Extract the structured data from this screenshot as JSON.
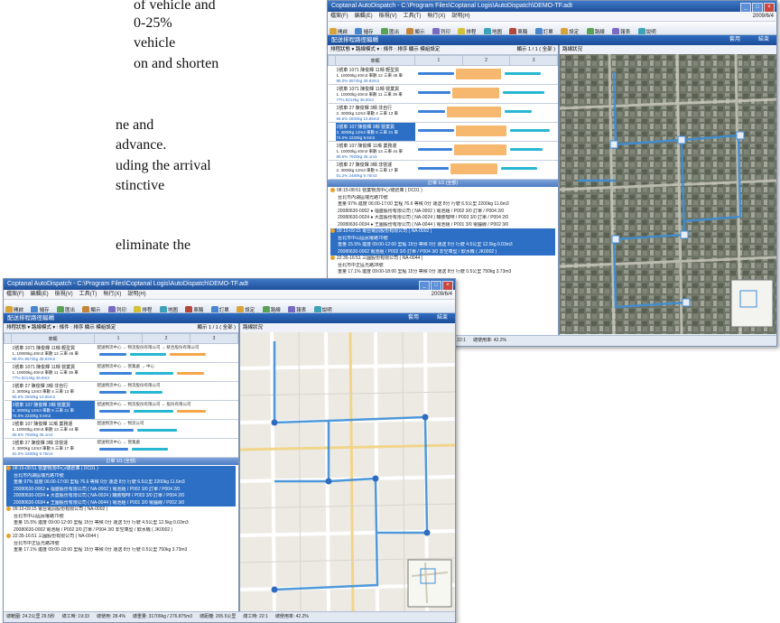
{
  "background_text": {
    "lines": [
      "of vehicle and",
      "0-25%",
      "vehicle",
      "on and shorten",
      "ne and",
      "advance.",
      "uding the arrival",
      "stinctive",
      "eliminate the"
    ]
  },
  "app": {
    "title": "Coptanal AutoDispatch - C:\\Program Files\\Coptanal Logis\\AutoDispatch\\DEMO-TF.adt",
    "menu": [
      "檔案(F)",
      "編輯(E)",
      "檢視(V)",
      "工具(T)",
      "執行(X)",
      "說明(H)"
    ],
    "date": "2009/6/4",
    "toolbar": [
      "開啟",
      "儲存",
      "匯出",
      "顯示",
      "列印",
      "排程",
      "地圖",
      "車輛",
      "訂單",
      "設定",
      "路線",
      "報表",
      "說明"
    ],
    "panel_title": "配送排程路徑編輯",
    "panel_btn1": "套用",
    "panel_btn2": "結束",
    "filter": "排程狀態 ▾  路線模式 ▾  :  條件  : 排序  顯示  模組設定",
    "filter_right": "顯示 1 / 1 ( 全部 )",
    "map_tab": "路線狀況",
    "grid_headers": [
      "",
      "車輛",
      "1",
      "2",
      "3"
    ],
    "rows": [
      {
        "name": "1號車 1071 陳俊輝 11噸 輕型貨",
        "detail": "1. 10000kg 40m3  車數 12 三車 46 車",
        "pct": "88.0% 8574kg 39.83m3",
        "stops": "配送物流中心 → 物流股份有限公司 → 統合股份有限公司"
      },
      {
        "name": "1號車 1071 陳俊輝 11噸 營業貨",
        "detail": "1. 10000kg 40m3  車數 11 三車 39 車",
        "pct": "77% 8214kg 36.8m3",
        "stops": "配送物流中心 → 營業處 → 中心"
      },
      {
        "name": "1號車 27 陳俊輝 3噸 非自行",
        "detail": "2. 3000kg 12m3  車數 4 三車 13 車",
        "pct": "86.6% 2600kg 10.85m3",
        "stops": "配送物流中心 → 物流股份有限公司"
      },
      {
        "name": "1號車 107 陳俊輝 3噸 營業貨",
        "detail": "3. 3000kg 12m3  車數 6 三車 21 車",
        "pct": "74.0% 2220kg 8.6m3",
        "stops": "配送物流中心 → 物流股份有限公司 → 股份有限公司"
      },
      {
        "name": "1號車 107 陳俊輝 11噸 業務運",
        "detail": "1. 10000kg 40m3  車數 13 三車 44 車",
        "pct": "86.6% 7920kg 35.1m3",
        "stops": "配送物流中心 → 物流公司"
      },
      {
        "name": "1號車 27 陳俊輝 3噸 非營運",
        "detail": "2. 3000kg 12m3  車數 5 三車 17 車",
        "pct": "81.2% 2480kg 9.75m3",
        "stops": "配送物流中心 → 營業處"
      }
    ],
    "splitter": "訂單 1/1 (全部)",
    "tree": [
      "08:15-08:51 營業物流中心/總倉庫 ( DC01 )",
      "台北市內湖區瑞光路70號",
      "重量 97%  進度 06:00-17:00  里程 76.6  等候 0分  運送 8分  行駛 6.5公里 2200kg 11.6m3",
      "20080630-0002 ● 福盛股份有限公司 ( NA-0002 ) 電池組 / P002 3/0 訂單 / P004 2/0",
      "20080630-0024 ● 大農股份有限公司 ( NA-0024 ) 罐裝咖啡 / P003 3/0 訂單 / P004 2/0",
      "20080630-0034 ● 王圖股份有限公司 ( NA-0044 ) 電池組 / P001 3/0 電腦線 / P002 3/0",
      "09:10-09:15 電台電訊股份有限公司 ( NA-0002 )",
      "台北市中山區民權路70號",
      "重量 15.5%  進度 09:00-12:00  里程 15分  等候 0分  運送 5分  行駛 4.5公里 12.5kg 0.03m3",
      "20080630-0002 電池組 / P002 3/0 訂單 / P004 3/0  非空車型 / 飲水機 ( JK0002 )",
      "22:35-16:51 三圓股份有限公司 ( NA-0044 )",
      "台北市中正區光路28號",
      "重量 17.1%  進度 09:00-18:00  里程 15分  等候 0分  運送 8分  行駛 0.5公里 750kg 3.73m3"
    ],
    "status": [
      "總範圍: 24.2公里 29.5秒",
      "總工時: 19:33",
      "總使用: 28.4%",
      "總重量: 31709kg / 276.875m3",
      "總距離: 205.5公里",
      "總工時: 22:1",
      "總使用率: 42.2%"
    ]
  },
  "colors": {
    "titlebar": "#1f4f99",
    "highlight": "#2d6fc4",
    "route": "#3c8ed6",
    "bar_blue": "#3d82d8",
    "bar_orange": "#f3a64a",
    "bar_cyan": "#28b7d3"
  },
  "icons": [
    "window-icon",
    "minimize-icon",
    "maximize-icon",
    "close-icon",
    "expand-icon",
    "vehicle-icon",
    "map-marker-icon"
  ]
}
